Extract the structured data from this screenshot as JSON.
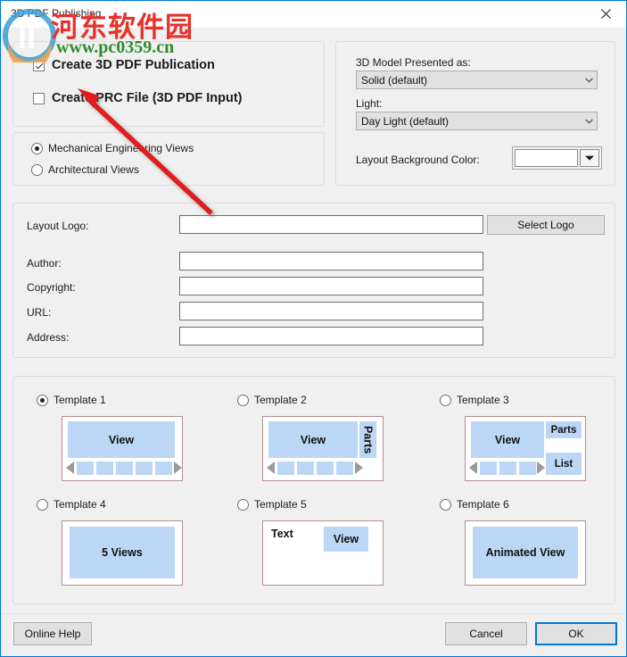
{
  "window": {
    "title": "3D PDF Publishing",
    "close_icon": "close-icon"
  },
  "watermark": {
    "site_name": "河东软件园",
    "url": "www.pc0359.cn"
  },
  "create_group": {
    "create_pdf": {
      "label": "Create 3D PDF Publication",
      "checked": true
    },
    "create_prc": {
      "label": "Create PRC File (3D PDF Input)",
      "checked": false
    }
  },
  "views_group": {
    "options": [
      {
        "label": "Mechanical Engineering Views",
        "selected": true
      },
      {
        "label": "Architectural Views",
        "selected": false
      }
    ]
  },
  "model_group": {
    "model_label": "3D Model Presented as:",
    "model_value": "Solid (default)",
    "light_label": "Light:",
    "light_value": "Day Light (default)",
    "background_label": "Layout Background Color:",
    "background_color": "#bcd7f5",
    "dropdown_icon": "chevron-down-icon"
  },
  "meta_group": {
    "fields": [
      {
        "label": "Layout Logo:",
        "value": "",
        "placeholder": ""
      },
      {
        "label": "Author:",
        "value": "",
        "placeholder": ""
      },
      {
        "label": "Copyright:",
        "value": "",
        "placeholder": ""
      },
      {
        "label": "URL:",
        "value": "",
        "placeholder": ""
      },
      {
        "label": "Address:",
        "value": "",
        "placeholder": ""
      }
    ],
    "select_logo_button": "Select Logo"
  },
  "templates": [
    {
      "label": "Template 1",
      "selected": true,
      "view_label": "View",
      "thumbs": 5,
      "panels": []
    },
    {
      "label": "Template 2",
      "selected": false,
      "view_label": "View",
      "thumbs": 4,
      "panels": [
        "Parts"
      ]
    },
    {
      "label": "Template 3",
      "selected": false,
      "view_label": "View",
      "thumbs": 3,
      "panels": [
        "Parts",
        "List"
      ]
    },
    {
      "label": "Template 4",
      "selected": false,
      "view_label": "5 Views",
      "thumbs": 0,
      "panels": []
    },
    {
      "label": "Template 5",
      "selected": false,
      "view_label": "View",
      "text_label": "Text",
      "thumbs": 0,
      "panels": []
    },
    {
      "label": "Template 6",
      "selected": false,
      "view_label": "Animated View",
      "thumbs": 0,
      "panels": []
    }
  ],
  "footer": {
    "online_help": "Online Help",
    "cancel": "Cancel",
    "ok": "OK"
  },
  "colors": {
    "accent": "#0078d7",
    "pane_blue": "#bcd7f5",
    "frame_red": "#b58f8f",
    "annotation_red": "#e01b1b"
  }
}
